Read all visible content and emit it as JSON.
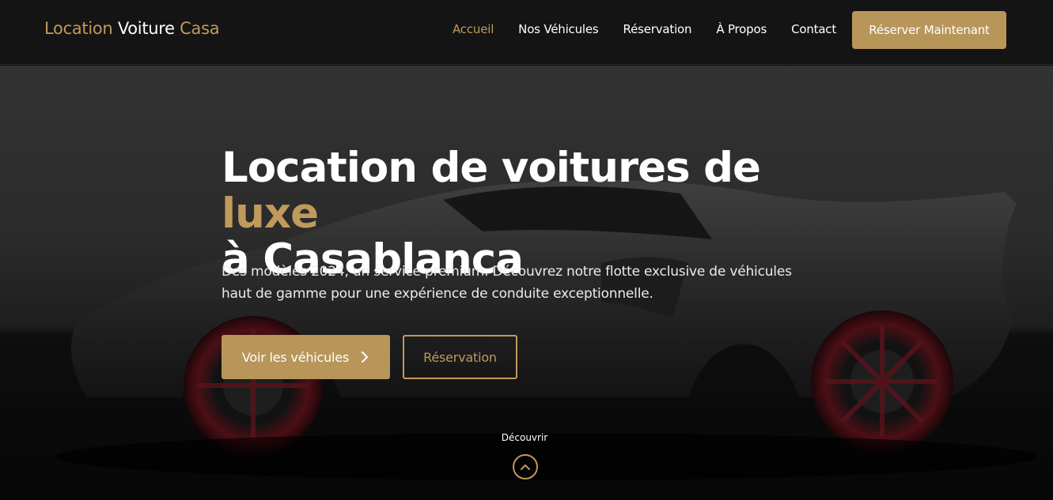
{
  "brand": {
    "part1": "Location",
    "part2": "Voiture",
    "part3": "Casa"
  },
  "nav": {
    "items": [
      {
        "label": "Accueil",
        "active": true
      },
      {
        "label": "Nos Véhicules",
        "active": false
      },
      {
        "label": "Réservation",
        "active": false
      },
      {
        "label": "À Propos",
        "active": false
      },
      {
        "label": "Contact",
        "active": false
      }
    ],
    "cta": "Réserver Maintenant"
  },
  "hero": {
    "title_part1": "Location de voitures de",
    "title_accent": "luxe",
    "title_part2": "à Casablanca",
    "subtitle": "Des modèles 2024, un service premium. Découvrez notre flotte exclusive de véhicules haut de gamme pour une expérience de conduite exceptionnelle.",
    "primary_button": "Voir les véhicules",
    "secondary_button": "Réservation",
    "discover_label": "Découvrir"
  },
  "icons": {
    "primary_button_icon": "chevron-right-icon",
    "discover_icon": "chevron-up-icon"
  },
  "colors": {
    "accent": "#b8965a",
    "navbar_bg": "#141414",
    "hero_bg": "#3a3a3a"
  }
}
